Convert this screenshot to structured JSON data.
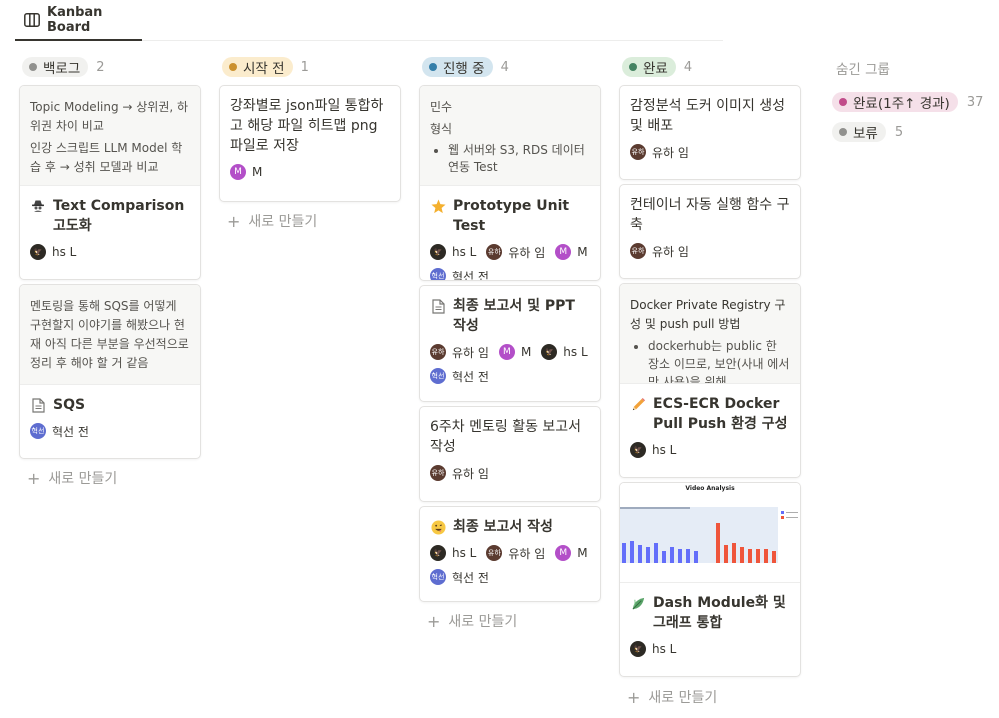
{
  "tab": {
    "label": "Kanban Board",
    "icon": "board-icon"
  },
  "new_label": "새로 만들기",
  "columns": [
    {
      "label": "백로그",
      "count": "2",
      "color": "#91918e",
      "bg": "#f1f1ef",
      "cards": [
        {
          "preview": [
            "Topic Modeling → 상위권, 하위권 차이 비교",
            "인강 스크립트 LLM Model 학습 후 → 성취 모델과 비교"
          ],
          "icon": "spy-icon",
          "title": "Text Comparison 고도화",
          "people": [
            {
              "name": "hs L",
              "av": "hsL"
            }
          ]
        },
        {
          "preview": [
            "멘토링을 통해 SQS를 어떻게 구현할지 이야기를 해봤으나 현재 아직 다른 부분을 우선적으로 정리 후 해야 할 거 같음"
          ],
          "icon": "document-icon",
          "title": "SQS",
          "people": [
            {
              "name": "혁선 전",
              "av": "혁선"
            }
          ]
        }
      ]
    },
    {
      "label": "시작 전",
      "count": "1",
      "color": "#cb912f",
      "bg": "#fbeccd",
      "cards": [
        {
          "title": "강좌별로 json파일 통합하고 해당 파일 히트맵 png 파일로 저장",
          "people": [
            {
              "name": "M",
              "av": "M"
            }
          ]
        }
      ]
    },
    {
      "label": "진행 중",
      "count": "4",
      "color": "#337ea9",
      "bg": "#d3e5ef",
      "cards": [
        {
          "preview_lines": [
            "민수",
            "형식"
          ],
          "preview_bullet": "웹 서버와 S3, RDS 데이터 연동 Test",
          "icon": "star-icon",
          "title": "Prototype Unit Test",
          "people": [
            {
              "name": "hs L",
              "av": "hsL"
            },
            {
              "name": "유하 임",
              "av": "유하"
            },
            {
              "name": "M",
              "av": "M"
            },
            {
              "name": "혁선 전",
              "av": "혁선"
            }
          ]
        },
        {
          "icon": "document-icon",
          "title": "최종 보고서 및 PPT 작성",
          "people": [
            {
              "name": "유하 임",
              "av": "유하"
            },
            {
              "name": "M",
              "av": "M"
            },
            {
              "name": "hs L",
              "av": "hsL"
            },
            {
              "name": "혁선 전",
              "av": "혁선"
            }
          ]
        },
        {
          "title": "6주차 멘토링 활동 보고서 작성",
          "people": [
            {
              "name": "유하 임",
              "av": "유하"
            }
          ]
        },
        {
          "icon": "smile-icon",
          "title": "최종 보고서 작성",
          "people": [
            {
              "name": "hs L",
              "av": "hsL"
            },
            {
              "name": "유하 임",
              "av": "유하"
            },
            {
              "name": "M",
              "av": "M"
            },
            {
              "name": "혁선 전",
              "av": "혁선"
            }
          ]
        }
      ]
    },
    {
      "label": "완료",
      "count": "4",
      "color": "#448361",
      "bg": "#dbeddb",
      "cards": [
        {
          "title": "감정분석 도커 이미지 생성 및 배포",
          "people": [
            {
              "name": "유하 임",
              "av": "유하"
            }
          ]
        },
        {
          "title": "컨테이너 자동 실행 함수 구축",
          "people": [
            {
              "name": "유하 임",
              "av": "유하"
            }
          ]
        },
        {
          "preview_lines": [
            "Docker Private Registry 구성 및 push pull 방법"
          ],
          "preview_bullet": "dockerhub는 public 한 장소 이므로, 보안(사내 에서만 사용)을 위해",
          "icon": "pencil-icon",
          "title": "ECS-ECR Docker Pull Push 환경 구성",
          "people": [
            {
              "name": "hs L",
              "av": "hsL"
            }
          ]
        },
        {
          "chart_title": "Video Analysis",
          "icon": "leaf-icon",
          "title": "Dash Module화 및 그래프 통합",
          "people": [
            {
              "name": "hs L",
              "av": "hsL"
            }
          ]
        }
      ]
    }
  ],
  "hidden_groups": {
    "title": "숨긴 그룹",
    "items": [
      {
        "label": "완료(1주↑ 경과)",
        "count": "37",
        "color": "#c14c8a",
        "bg": "#f5e0e9"
      },
      {
        "label": "보류",
        "count": "5",
        "color": "#91918e",
        "bg": "#f1f1ef"
      }
    ]
  }
}
